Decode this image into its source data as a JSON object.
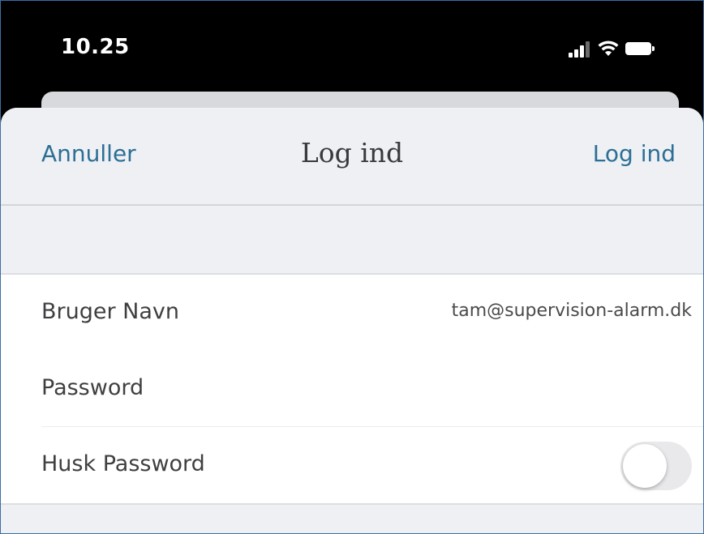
{
  "status_bar": {
    "time": "10.25",
    "icons": [
      "signal-icon",
      "wifi-icon",
      "battery-icon"
    ]
  },
  "nav": {
    "cancel_label": "Annuller",
    "title": "Log ind",
    "login_label": "Log ind"
  },
  "form": {
    "username": {
      "label": "Bruger Navn",
      "value": "tam@supervision-alarm.dk"
    },
    "password": {
      "label": "Password",
      "value": "",
      "placeholder": ""
    },
    "remember": {
      "label": "Husk Password",
      "enabled": false
    }
  },
  "colors": {
    "accent": "#2b6f95",
    "background": "#eff0f4",
    "status_bar": "#000000"
  }
}
